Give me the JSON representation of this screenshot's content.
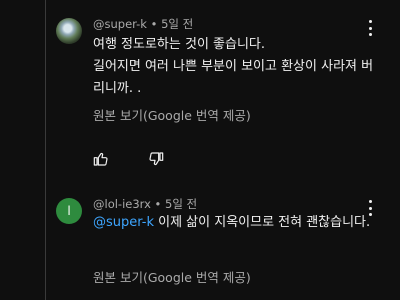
{
  "comments": [
    {
      "author": "@super-k",
      "time": "5일 전",
      "lines": [
        "여행 정도로하는 것이 좋습니다.",
        "길어지면 여러 나쁜 부분이 보이고 환상이 사라져 버리니까. ."
      ],
      "translate_label": "원본 보기(Google 번역 제공)",
      "avatar_icon": "landscape-photo-avatar"
    },
    {
      "author": "@lol-ie3rx",
      "time": "5일 전",
      "avatar_letter": "l",
      "avatar_color": "#2e8b3e",
      "mention": "@super-k",
      "text": "  이제 삶이 지옥이므로 전혀 괜찮습니다.",
      "translate_label": "원본 보기(Google 번역 제공)"
    }
  ],
  "actions": {
    "like_icon": "thumb-up-icon",
    "dislike_icon": "thumb-down-icon"
  },
  "more_icon": "more-vert-icon",
  "colors": {
    "background": "#0f0f0f",
    "text": "#f1f1f1",
    "secondary": "#aaaaaa",
    "mention": "#3ea6ff"
  }
}
